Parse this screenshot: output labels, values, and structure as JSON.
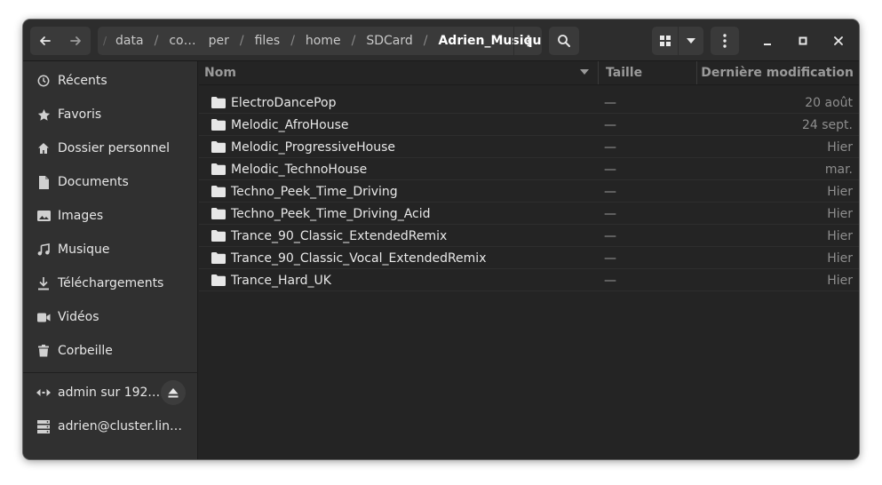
{
  "headerbar": {
    "path_fade": "/",
    "path_segments": [
      "data",
      "co…",
      "per",
      "files",
      "home",
      "SDCard"
    ],
    "path_current": "Adrien_Musique",
    "path_separator": "/"
  },
  "sidebar": {
    "places": [
      {
        "label": "Récents",
        "icon": "clock-icon"
      },
      {
        "label": "Favoris",
        "icon": "star-icon"
      },
      {
        "label": "Dossier personnel",
        "icon": "home-icon"
      },
      {
        "label": "Documents",
        "icon": "document-icon"
      },
      {
        "label": "Images",
        "icon": "image-icon"
      },
      {
        "label": "Musique",
        "icon": "music-note-icon"
      },
      {
        "label": "Téléchargements",
        "icon": "download-icon"
      },
      {
        "label": "Vidéos",
        "icon": "video-camera-icon"
      },
      {
        "label": "Corbeille",
        "icon": "trash-icon"
      }
    ],
    "network": [
      {
        "label": "admin sur 192.…",
        "icon": "network-share-icon"
      },
      {
        "label": "adrien@cluster.lin…",
        "icon": "server-icon"
      }
    ]
  },
  "columns": {
    "name": "Nom",
    "size": "Taille",
    "modified": "Dernière modification"
  },
  "files": [
    {
      "name": "ElectroDancePop",
      "size": "—",
      "modified": "20 août"
    },
    {
      "name": "Melodic_AfroHouse",
      "size": "—",
      "modified": "24 sept."
    },
    {
      "name": "Melodic_ProgressiveHouse",
      "size": "—",
      "modified": "Hier"
    },
    {
      "name": "Melodic_TechnoHouse",
      "size": "—",
      "modified": "mar."
    },
    {
      "name": "Techno_Peek_Time_Driving",
      "size": "—",
      "modified": "Hier"
    },
    {
      "name": "Techno_Peek_Time_Driving_Acid",
      "size": "—",
      "modified": "Hier"
    },
    {
      "name": "Trance_90_Classic_ExtendedRemix",
      "size": "—",
      "modified": "Hier"
    },
    {
      "name": "Trance_90_Classic_Vocal_ExtendedRemix",
      "size": "—",
      "modified": "Hier"
    },
    {
      "name": "Trance_Hard_UK",
      "size": "—",
      "modified": "Hier"
    }
  ],
  "colors": {
    "window_bg": "#242424",
    "headerbar_bg": "#2d2d2d",
    "sidebar_bg": "#303030",
    "button_bg": "#3a3a3a"
  }
}
